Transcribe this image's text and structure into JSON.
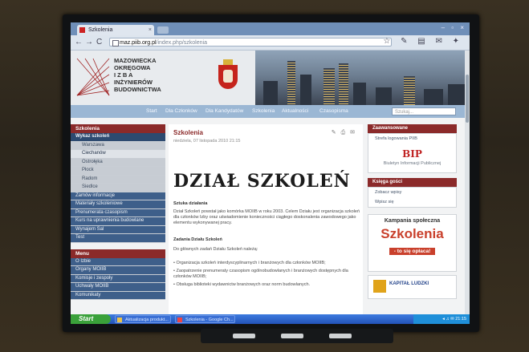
{
  "browser": {
    "tab_title": "Szkolenia",
    "tab_close": "×",
    "url_host": "maz.piib.org.pl",
    "url_path": "/index.php/szkolenia",
    "back": "←",
    "forward": "→",
    "reload": "C",
    "window_buttons": "– ▫ ×",
    "toolbar_icons": "☆ ✎ ▤ ✉ ✦"
  },
  "site": {
    "org_name": [
      "MAZOWIECKA",
      "OKRĘGOWA",
      "I Z B A",
      "INŻYNIERÓW",
      "BUDOWNICTWA"
    ],
    "nav": [
      "Start",
      "Dla Członków",
      "Dla Kandydatów",
      "Szkolenia",
      "Aktualności",
      "Czasopisma"
    ],
    "search_placeholder": "Szukaj..."
  },
  "left_sidebar": {
    "header": "Szkolenia",
    "items": [
      {
        "label": "Wykaz szkoleń",
        "kind": "active"
      },
      {
        "label": "Warszawa",
        "kind": "sub"
      },
      {
        "label": "Ciechanów",
        "kind": "sub highlight"
      },
      {
        "label": "Ostrołęka",
        "kind": "sub"
      },
      {
        "label": "Płock",
        "kind": "sub"
      },
      {
        "label": "Radom",
        "kind": "sub"
      },
      {
        "label": "Siedlce",
        "kind": "sub"
      },
      {
        "label": "Zamów informacje",
        "kind": "item"
      },
      {
        "label": "Materiały szkoleniowe",
        "kind": "item"
      },
      {
        "label": "Prenumerata czasopism",
        "kind": "item"
      },
      {
        "label": "Kurs na uprawnienia budowlane",
        "kind": "item"
      },
      {
        "label": "Wynajem Sal",
        "kind": "item"
      },
      {
        "label": "Test",
        "kind": "item"
      }
    ],
    "menu_header": "Menu",
    "menu_items": [
      "O Izbie",
      "Organy MOIIB",
      "Komisje i zespoły",
      "Uchwały MOIIB",
      "Komunikaty"
    ]
  },
  "main": {
    "title": "Szkolenia",
    "date": "niedziela, 07 listopada 2010 21:15",
    "tool_icons": "✎ ⎙ ✉",
    "banner": "DZIAŁ SZKOLEŃ",
    "section1_title": "Sztuka działania",
    "section1_body": "Dział Szkoleń powstał jako komórka MOIIB w roku 2003. Celem Działu jest organizacja szkoleń dla członków Izby oraz uświadomienie konieczności ciągłego doskonalenia zawodowego jako elementu wykonywanej pracy.",
    "section2_title": "Zadania Działu Szkoleń",
    "section2_lead": "Do głównych zadań Działu Szkoleń należą:",
    "bullets": [
      "• Organizacja szkoleń interdyscyplinarnych i branżowych dla członków MOIIB;",
      "• Zaopatrzenie prenumeraty czasopism ogólnobudowlanych i branżowych dostępnych dla członków MOIIB;",
      "• Obsługa biblioteki wydawnictw branżowych oraz norm budowlanych."
    ]
  },
  "right_sidebar": {
    "header1": "Zaawansowane",
    "link1": "Strefa logowania PIIB",
    "bip_logo": "BIP",
    "bip_text": "Biuletyn Informacji Publicznej",
    "header2": "Księga gości",
    "links2": [
      "Zobacz wpisy",
      "Wpisz się"
    ],
    "promo_title": "Kampania społeczna",
    "promo_big": "Szkolenia",
    "promo_sub": "- to się opłaca!",
    "promo2_text": "KAPITAŁ LUDZKI"
  },
  "taskbar": {
    "start": "Start",
    "tasks": [
      "Aktualizacja produkt...",
      "Szkolenia - Google Ch..."
    ],
    "tray": "◂ ♫ ✉ 21:15"
  }
}
